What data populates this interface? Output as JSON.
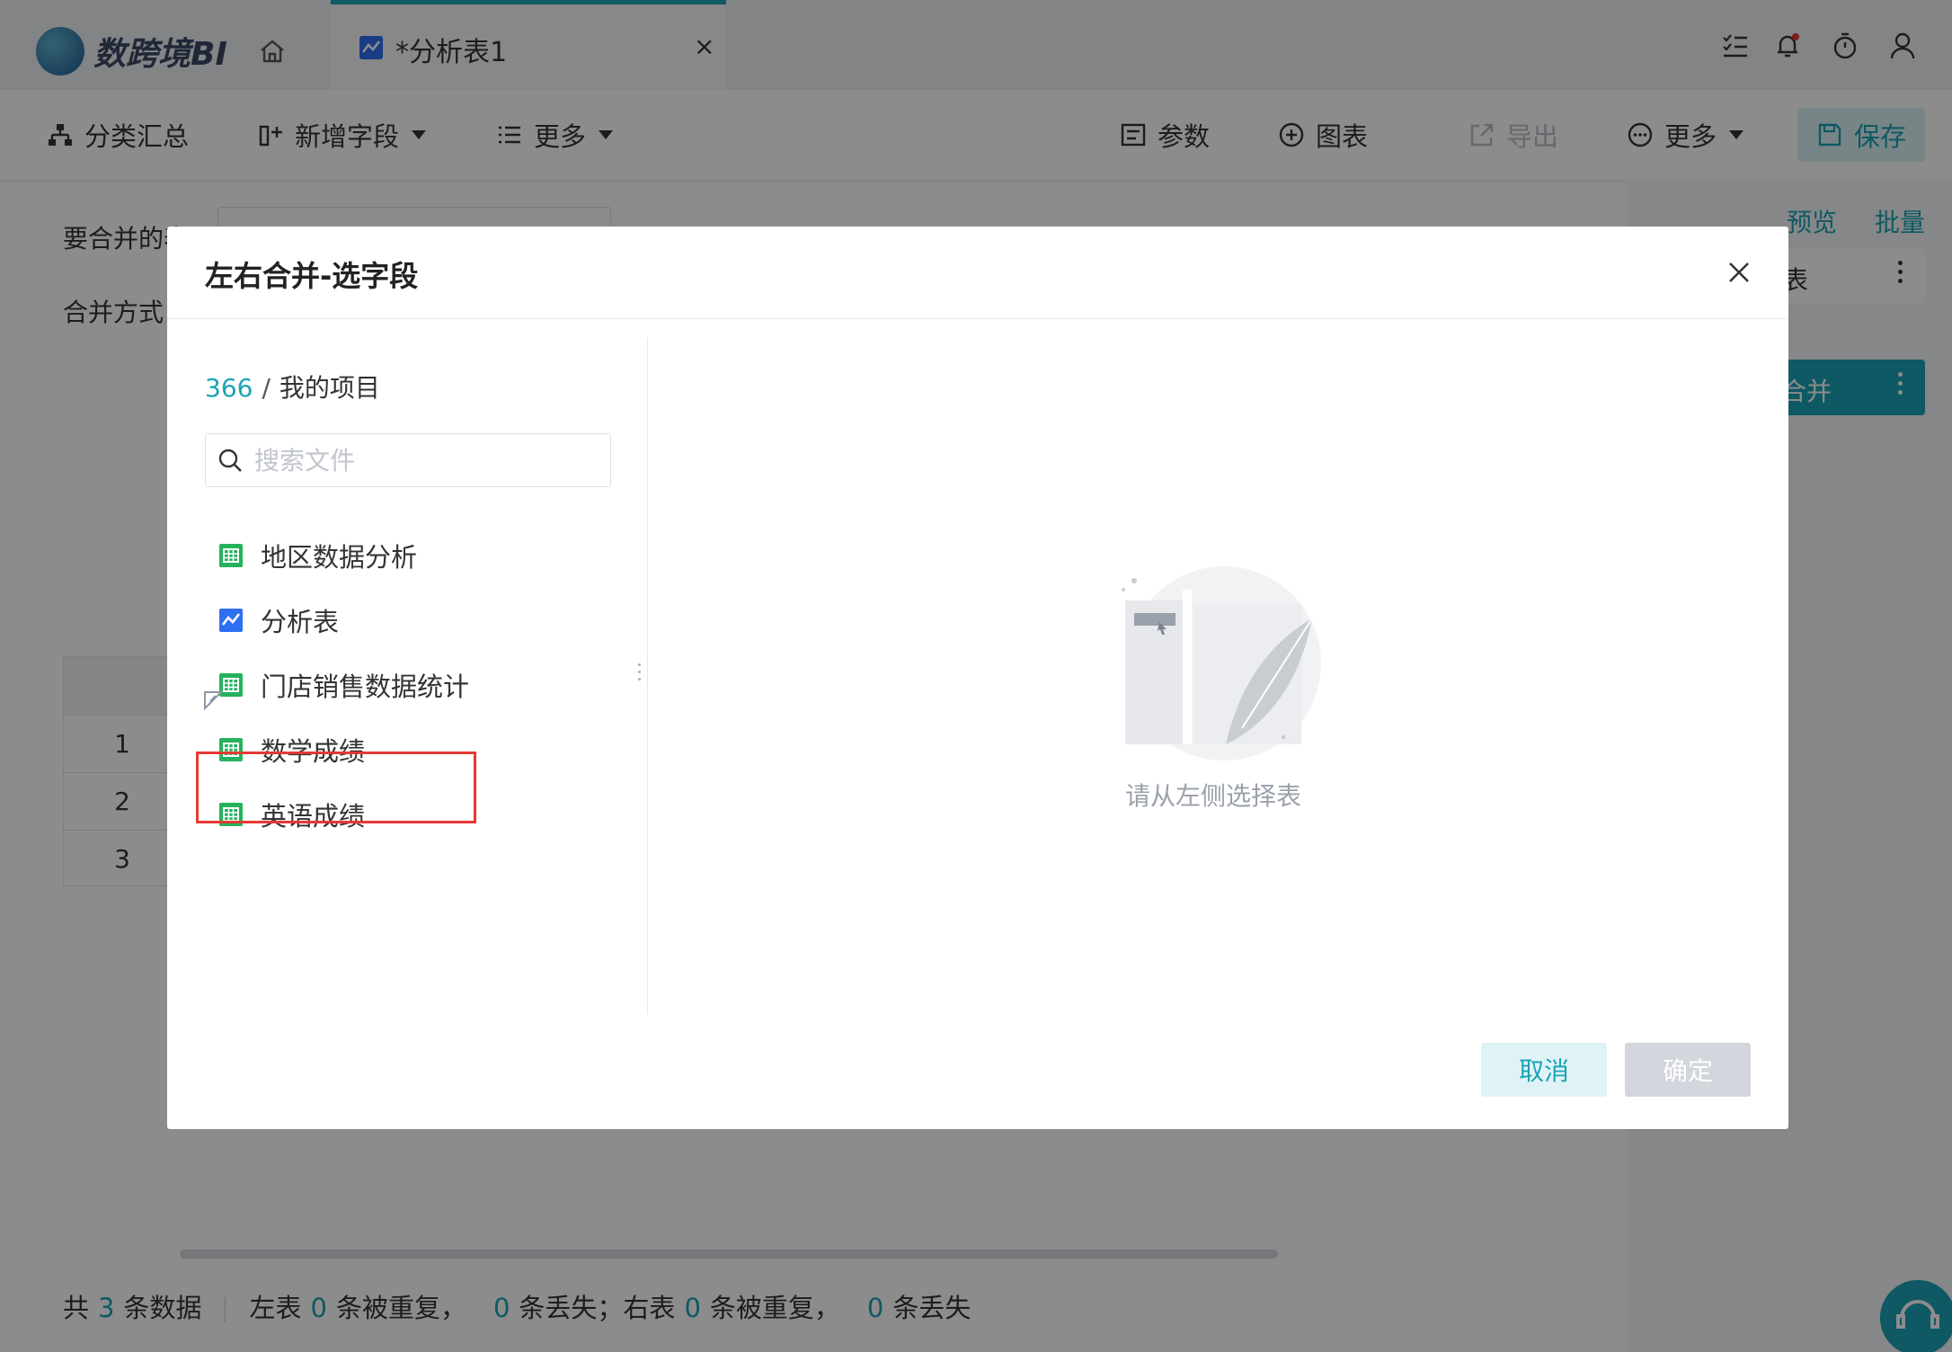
{
  "app": {
    "logo_text": "数跨境BI",
    "tab_label": "*分析表1",
    "tab_close": "×"
  },
  "toolbar": {
    "group_summary": "分类汇总",
    "add_field": "新增字段",
    "more_left": "更多",
    "params": "参数",
    "chart": "图表",
    "export": "导出",
    "more_right": "更多",
    "save": "保存"
  },
  "background": {
    "merge_tables_label": "要合并的表",
    "merge_method_label": "合并方式",
    "preview_link": "预览",
    "batch_link": "批量",
    "table_card_label": "表",
    "merge_card_label": "合并",
    "row_numbers": [
      "1",
      "2",
      "3"
    ],
    "status": {
      "total_prefix": "共",
      "total_count": "3",
      "total_suffix": "条数据",
      "left_prefix": "左表",
      "left_dup_count": "0",
      "left_dup_suffix": "条被重复，",
      "left_lost_count": "0",
      "left_lost_suffix": "条丢失；右表",
      "right_dup_count": "0",
      "right_dup_suffix": "条被重复，",
      "right_lost_count": "0",
      "right_lost_suffix": "条丢失"
    }
  },
  "modal": {
    "title": "左右合并-选字段",
    "breadcrumb": {
      "root": "366",
      "separator": "/",
      "current": "我的项目"
    },
    "search_placeholder": "搜索文件",
    "files": [
      {
        "name": "地区数据分析",
        "icon": "table-icon"
      },
      {
        "name": "分析表",
        "icon": "analysis-icon"
      },
      {
        "name": "门店销售数据统计",
        "icon": "table-icon"
      },
      {
        "name": "数学成绩",
        "icon": "table-icon"
      },
      {
        "name": "英语成绩",
        "icon": "table-icon"
      }
    ],
    "empty_text": "请从左侧选择表",
    "cancel_label": "取消",
    "ok_label": "确定"
  },
  "colors": {
    "accent": "#1aa3b5",
    "highlight_border": "#e53935",
    "table_icon": "#25b25c",
    "analysis_icon": "#2d6ff0"
  }
}
